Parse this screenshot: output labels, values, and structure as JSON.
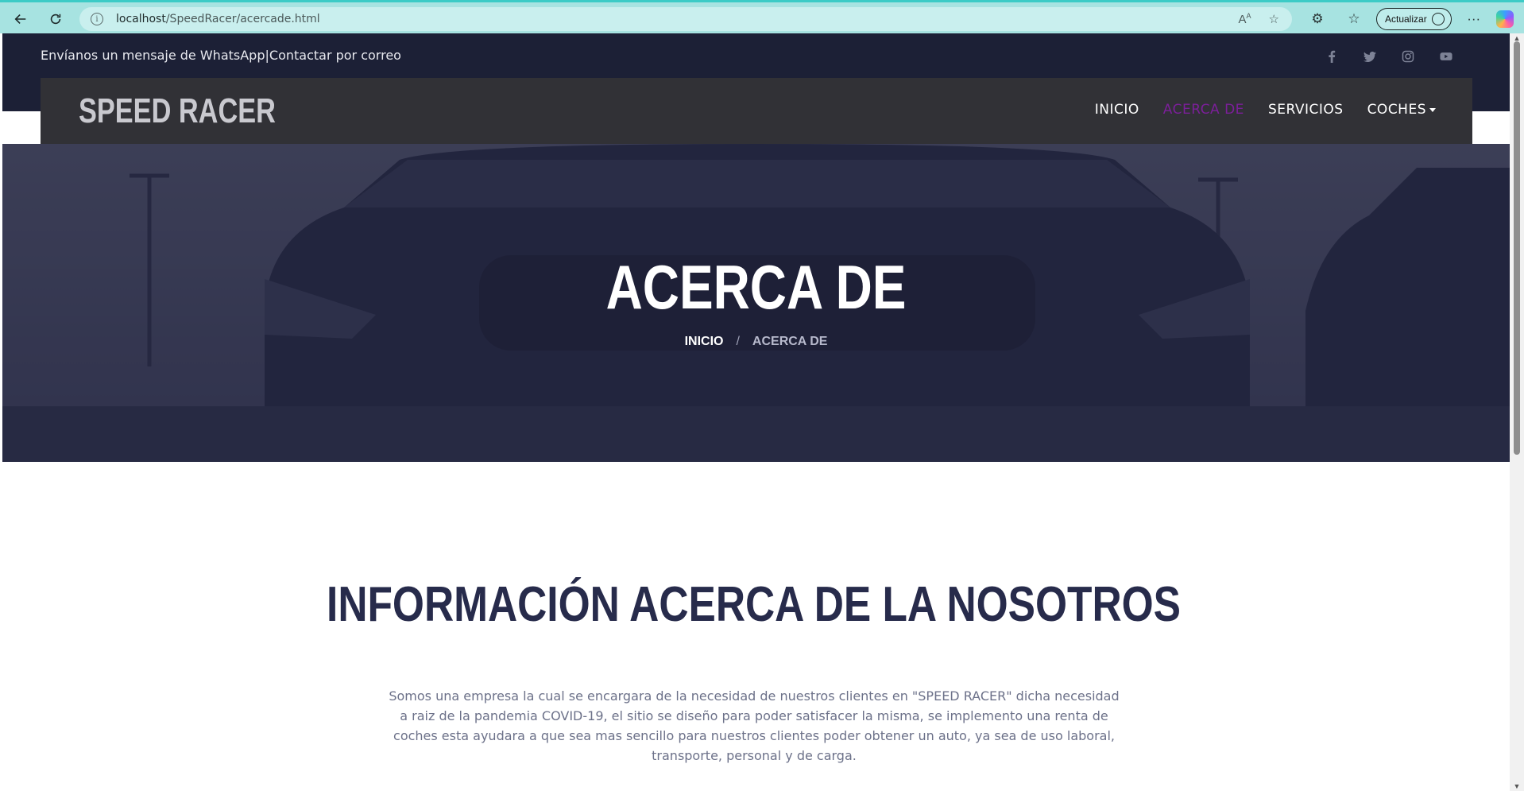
{
  "browser": {
    "url_host": "localhost",
    "url_path": "/SpeedRacer/acercade.html",
    "update_label": "Actualizar"
  },
  "topbar": {
    "whatsapp_label": "Envíanos un mensaje de WhatsApp",
    "separator": "|",
    "email_label": "Contactar por correo",
    "socials": [
      "facebook-icon",
      "twitter-icon",
      "instagram-icon",
      "youtube-icon"
    ]
  },
  "navbar": {
    "brand": "SPEED RACER",
    "items": [
      {
        "label": "INICIO",
        "active": false
      },
      {
        "label": "ACERCA DE",
        "active": true
      },
      {
        "label": "SERVICIOS",
        "active": false
      },
      {
        "label": "COCHES",
        "active": false,
        "dropdown": true
      }
    ],
    "active_color": "#7b1f99"
  },
  "hero": {
    "title": "ACERCA DE",
    "breadcrumb_home": "INICIO",
    "breadcrumb_sep": "/",
    "breadcrumb_current": "ACERCA DE"
  },
  "about": {
    "title": "INFORMACIÓN ACERCA DE LA NOSOTROS",
    "text": "Somos una empresa la cual se encargara de la necesidad de nuestros clientes en \"SPEED RACER\" dicha necesidad a raiz de la pandemia COVID-19, el sitio se diseño para poder satisfacer la misma, se implemento una renta de coches esta ayudara a que sea mas sencillo para nuestros clientes poder obtener un auto, ya sea de uso laboral, transporte, personal y de carga."
  },
  "colors": {
    "browser_bar": "#a7e3e1",
    "topbar": "#1c2036",
    "navbar": "#313136",
    "heading": "#272b4b"
  }
}
